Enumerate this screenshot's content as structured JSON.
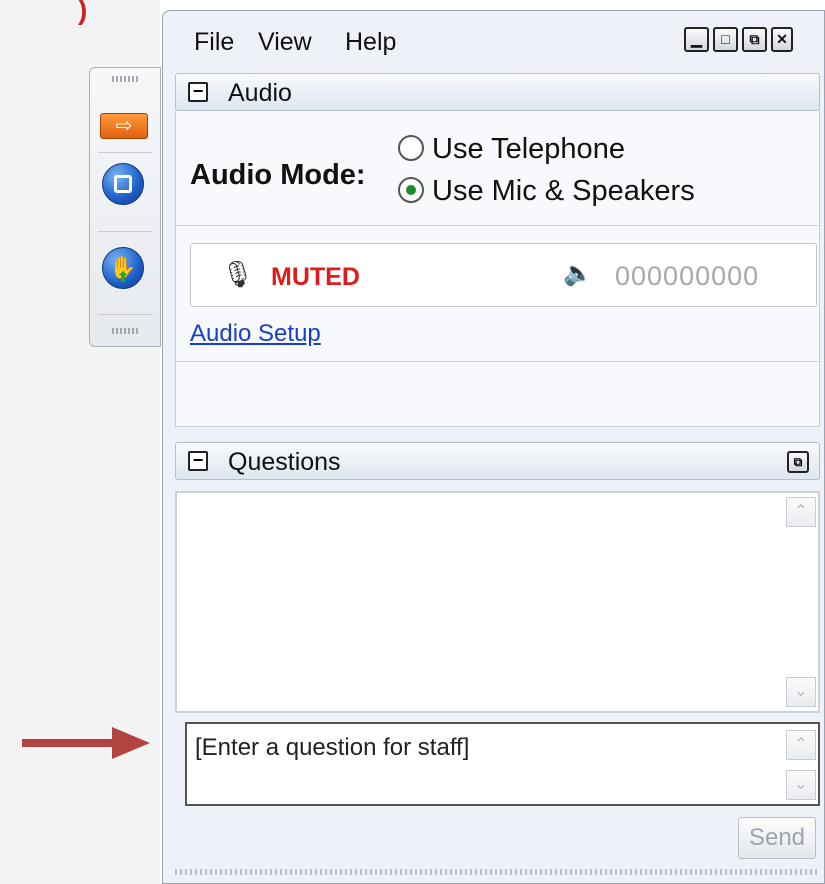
{
  "menu": {
    "file": "File",
    "view": "View",
    "help": "Help"
  },
  "window_controls": {
    "minimize_glyph": "▁",
    "maximize_glyph": "□",
    "restore_glyph": "⧉",
    "close_glyph": "✕"
  },
  "toolbar": {
    "icons": [
      "arrow-button-icon",
      "stop-icon",
      "raise-hand-icon"
    ],
    "arrow_glyph": "⇨",
    "hand_glyph": "✋",
    "up_glyph": "⬆"
  },
  "audio": {
    "section_title": "Audio",
    "collapse_glyph": "−",
    "mode_label": "Audio Mode:",
    "options": [
      {
        "label": "Use Telephone",
        "selected": false
      },
      {
        "label": "Use Mic & Speakers",
        "selected": true
      }
    ],
    "mic_glyph": "🎙",
    "status": "MUTED",
    "speaker_glyph": "🔈",
    "level_value": "000000000",
    "setup_link": "Audio Setup"
  },
  "questions": {
    "section_title": "Questions",
    "collapse_glyph": "−",
    "expand_glyph": "⧉",
    "input_value": "[Enter a question for staff]",
    "scroll_up_glyph": "⌃",
    "scroll_down_glyph": "⌄",
    "send_label": "Send"
  },
  "colors": {
    "muted": "#e01b1b",
    "link": "#1a3fc7",
    "selected_radio": "#1a8b2e",
    "pointer_arrow": "#b2433f"
  }
}
